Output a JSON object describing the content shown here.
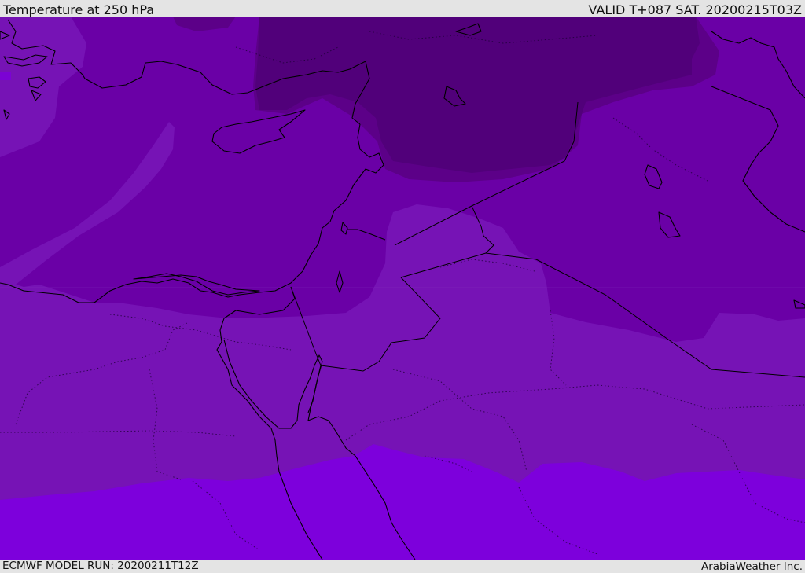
{
  "header": {
    "title": "Temperature at 250 hPa",
    "valid": "VALID T+087 SAT. 20200215T03Z"
  },
  "footer": {
    "model_run": "ECMWF MODEL RUN: 20200211T12Z",
    "credit": "ArabiaWeather Inc."
  },
  "colors": {
    "frame_background": "#e4e4e4",
    "text": "#111111",
    "temp_band_light": "#7d00dc",
    "temp_band_mid": "#7613b5",
    "temp_band_mid_dark": "#6a00a6",
    "temp_band_dark": "#5c0088",
    "temp_band_darkest": "#51007a",
    "coastline": "#000000"
  }
}
